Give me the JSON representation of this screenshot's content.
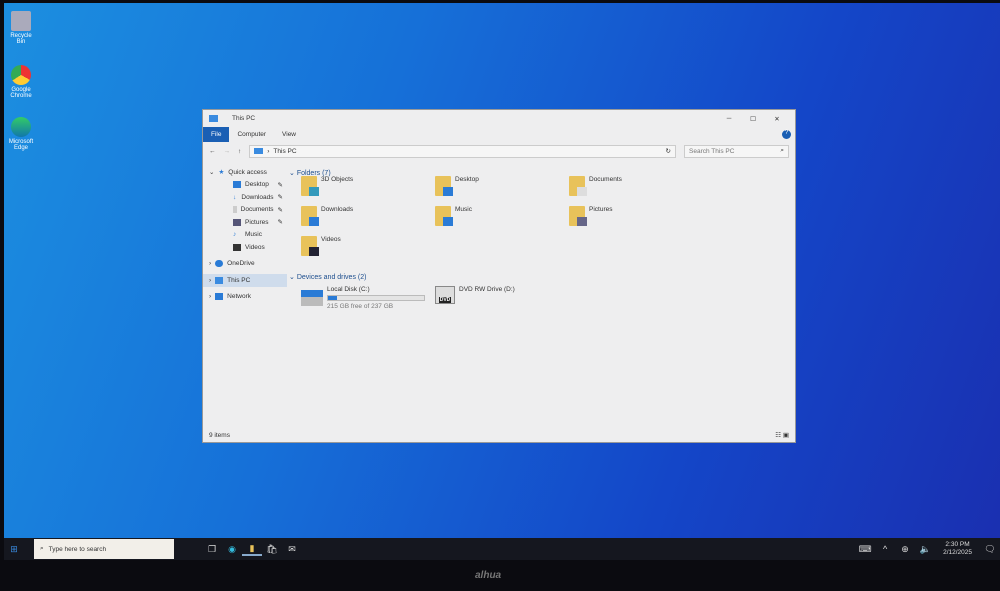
{
  "desktop": [
    {
      "label": "Recycle Bin",
      "color": "#aab"
    },
    {
      "label": "Google Chrome",
      "color": "#e33"
    },
    {
      "label": "Microsoft Edge",
      "color": "#1aa"
    }
  ],
  "window": {
    "title": "This PC",
    "tabs": [
      "File",
      "Computer",
      "View"
    ],
    "path": "This PC",
    "search_placeholder": "Search This PC",
    "status": "9 items"
  },
  "nav": {
    "quick_access": "Quick access",
    "quick": [
      {
        "label": "Desktop",
        "pinned": true,
        "color": "#2a7bd6"
      },
      {
        "label": "Downloads",
        "pinned": true,
        "color": "#2a7bd6"
      },
      {
        "label": "Documents",
        "pinned": true,
        "color": "#999"
      },
      {
        "label": "Pictures",
        "pinned": true,
        "color": "#557"
      },
      {
        "label": "Music",
        "pinned": false,
        "color": "#2a7bd6"
      },
      {
        "label": "Videos",
        "pinned": false,
        "color": "#333"
      }
    ],
    "onedrive": "OneDrive",
    "thispc": "This PC",
    "network": "Network",
    "pin": "✎"
  },
  "folders": {
    "header": "Folders (7)",
    "items": [
      {
        "label": "3D Objects",
        "color": "#39b"
      },
      {
        "label": "Desktop",
        "color": "#2a7bd6"
      },
      {
        "label": "Documents",
        "color": "#ddd"
      },
      {
        "label": "Downloads",
        "color": "#2a7bd6"
      },
      {
        "label": "Music",
        "color": "#2a7bd6"
      },
      {
        "label": "Pictures",
        "color": "#668"
      },
      {
        "label": "Videos",
        "color": "#223"
      }
    ]
  },
  "drives": {
    "header": "Devices and drives (2)",
    "c": {
      "label": "Local Disk (C:)",
      "free": "215 GB free of 237 GB",
      "used_fraction": 0.093
    },
    "d": {
      "label": "DVD RW Drive (D:)",
      "badge": "DVD"
    }
  },
  "taskbar": {
    "search": "Type here to search",
    "time": "2:30 PM",
    "date": "2/12/2025"
  },
  "brand": "alhua"
}
